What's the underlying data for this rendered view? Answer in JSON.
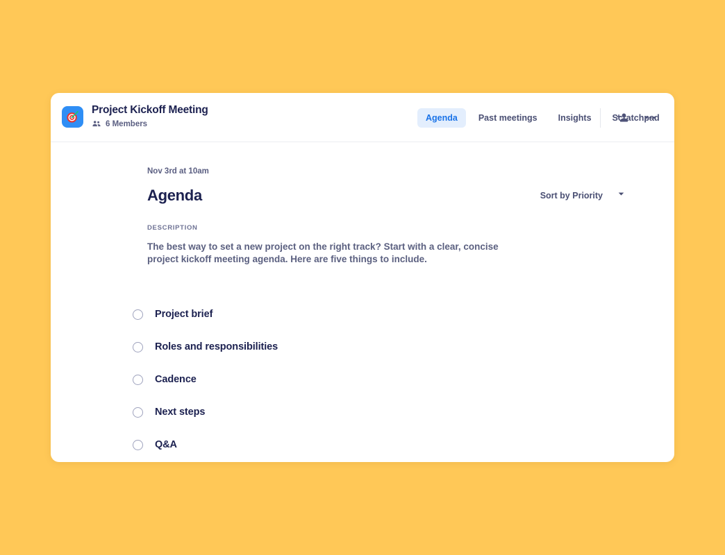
{
  "theme": {
    "background": "#ffc857",
    "card": "#ffffff",
    "accent": "#1a73e8",
    "accent_bg": "#e3eefd",
    "text_dark": "#1c2150",
    "text_muted": "#5b5f82",
    "icon_bg": "#2f8ef5"
  },
  "header": {
    "app_icon": "dartboard-target-icon",
    "title": "Project Kickoff Meeting",
    "members_icon": "people-group-icon",
    "members": "6 Members",
    "tabs": [
      {
        "label": "Agenda",
        "active": true
      },
      {
        "label": "Past meetings",
        "active": false
      },
      {
        "label": "Insights",
        "active": false
      },
      {
        "label": "Scratchpad",
        "active": false
      }
    ],
    "actions": [
      {
        "icon": "add-person-icon"
      },
      {
        "icon": "more-options-icon"
      }
    ]
  },
  "main": {
    "date": "Nov 3rd at 10am",
    "title": "Agenda",
    "sort": {
      "label": "Sort by Priority",
      "icon": "chevron-down-icon"
    },
    "description_label": "DESCRIPTION",
    "description": "The best way to set a new project on the right track? Start with a clear, concise project kickoff meeting agenda. Here are five things to include.",
    "agenda_items": [
      {
        "label": "Project brief",
        "checked": false
      },
      {
        "label": "Roles and responsibilities",
        "checked": false
      },
      {
        "label": "Cadence",
        "checked": false
      },
      {
        "label": "Next steps",
        "checked": false
      },
      {
        "label": "Q&A",
        "checked": false
      }
    ]
  }
}
